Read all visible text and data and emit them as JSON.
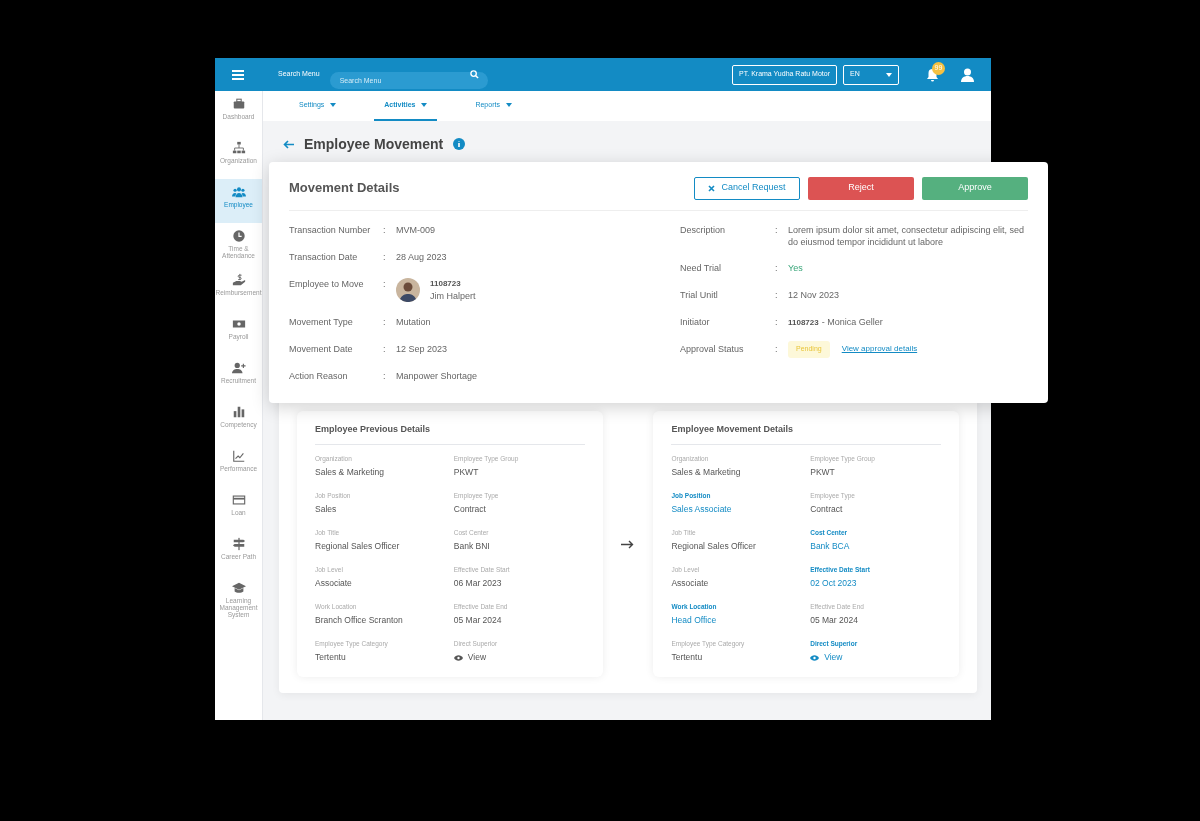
{
  "header": {
    "menu_label": "Search Menu",
    "search_placeholder": "Search Menu",
    "company": "PT. Krama Yudha Ratu Motor",
    "language": "EN",
    "notification_count": "99"
  },
  "sidebar": {
    "items": [
      {
        "label": "Dashboard",
        "selected": false
      },
      {
        "label": "Organization",
        "selected": false
      },
      {
        "label": "Employee",
        "selected": true
      },
      {
        "label": "Time & Attendance",
        "selected": false
      },
      {
        "label": "Reimbursement",
        "selected": false
      },
      {
        "label": "Payroll",
        "selected": false
      },
      {
        "label": "Recruitment",
        "selected": false
      },
      {
        "label": "Competency",
        "selected": false
      },
      {
        "label": "Performance",
        "selected": false
      },
      {
        "label": "Loan",
        "selected": false
      },
      {
        "label": "Career Path",
        "selected": false
      },
      {
        "label": "Learning Management System",
        "selected": false
      }
    ]
  },
  "tabs": [
    {
      "label": "Settings",
      "selected": false
    },
    {
      "label": "Activities",
      "selected": true
    },
    {
      "label": "Reports",
      "selected": false
    }
  ],
  "page_title": "Employee Movement",
  "details": {
    "title": "Movement Details",
    "actions": [
      {
        "label": "Cancel Request",
        "kind": "cancel"
      },
      {
        "label": "Reject",
        "kind": "reject"
      },
      {
        "label": "Approve",
        "kind": "approve"
      }
    ],
    "left_fields": [
      {
        "label": "Transaction Number",
        "separator": ":",
        "kind": "text",
        "value": "MVM-009"
      },
      {
        "label": "Transaction Date",
        "separator": ":",
        "kind": "text",
        "value": "28 Aug 2023"
      },
      {
        "label": "Employee to Move",
        "separator": ":",
        "kind": "employee",
        "id": "1108723",
        "value": "Jim Halpert"
      },
      {
        "label": "Movement Type",
        "separator": ":",
        "kind": "text",
        "value": "Mutation"
      },
      {
        "label": "Movement Date",
        "separator": ":",
        "kind": "text",
        "value": "12 Sep 2023"
      },
      {
        "label": "Action Reason",
        "separator": ":",
        "kind": "text",
        "value": "Manpower Shortage"
      }
    ],
    "right_fields": [
      {
        "label": "Description",
        "separator": ":",
        "kind": "text",
        "value": "Lorem ipsum dolor sit amet, consectetur adipiscing elit, sed do eiusmod tempor incididunt ut labore"
      },
      {
        "label": "Need Trial",
        "separator": ":",
        "kind": "accent",
        "value": "Yes"
      },
      {
        "label": "Trial Unitl",
        "separator": ":",
        "kind": "text",
        "value": "12 Nov 2023"
      },
      {
        "label": "Initiator",
        "separator": ":",
        "kind": "initiator",
        "id": "1108723",
        "value": "- Monica Geller"
      },
      {
        "label": "Approval Status",
        "separator": ":",
        "kind": "status",
        "value": "Pending",
        "link": "View approval details"
      }
    ]
  },
  "comparison": [
    {
      "title": "Employee Previous Details",
      "fields": [
        {
          "label": "Organization",
          "value": "Sales & Marketing",
          "changed": false,
          "kind": "text"
        },
        {
          "label": "Employee Type Group",
          "value": "PKWT",
          "changed": false,
          "kind": "text"
        },
        {
          "label": "Job Position",
          "value": "Sales",
          "changed": false,
          "kind": "text"
        },
        {
          "label": "Employee Type",
          "value": "Contract",
          "changed": false,
          "kind": "text"
        },
        {
          "label": "Job Title",
          "value": "Regional Sales Officer",
          "changed": false,
          "kind": "text"
        },
        {
          "label": "Cost Center",
          "value": "Bank BNI",
          "changed": false,
          "kind": "text"
        },
        {
          "label": "Job Level",
          "value": "Associate",
          "changed": false,
          "kind": "text"
        },
        {
          "label": "Effective Date Start",
          "value": "06 Mar 2023",
          "changed": false,
          "kind": "text"
        },
        {
          "label": "Work Location",
          "value": "Branch Office Scranton",
          "changed": false,
          "kind": "text"
        },
        {
          "label": "Effective Date End",
          "value": "05 Mar 2024",
          "changed": false,
          "kind": "text"
        },
        {
          "label": "Employee Type Category",
          "value": "Tertentu",
          "changed": false,
          "kind": "text"
        },
        {
          "label": "Direct Superior",
          "value": "View",
          "changed": false,
          "kind": "view"
        }
      ]
    },
    {
      "title": "Employee Movement Details",
      "fields": [
        {
          "label": "Organization",
          "value": "Sales & Marketing",
          "changed": false,
          "kind": "text"
        },
        {
          "label": "Employee Type Group",
          "value": "PKWT",
          "changed": false,
          "kind": "text"
        },
        {
          "label": "Job Position",
          "value": "Sales Associate",
          "changed": true,
          "kind": "text"
        },
        {
          "label": "Employee Type",
          "value": "Contract",
          "changed": false,
          "kind": "text"
        },
        {
          "label": "Job Title",
          "value": "Regional Sales Officer",
          "changed": false,
          "kind": "text"
        },
        {
          "label": "Cost Center",
          "value": "Bank BCA",
          "changed": true,
          "kind": "text"
        },
        {
          "label": "Job Level",
          "value": "Associate",
          "changed": false,
          "kind": "text"
        },
        {
          "label": "Effective Date Start",
          "value": "02 Oct 2023",
          "changed": true,
          "kind": "text"
        },
        {
          "label": "Work Location",
          "value": "Head Office",
          "changed": true,
          "kind": "text"
        },
        {
          "label": "Effective Date End",
          "value": "05 Mar 2024",
          "changed": false,
          "kind": "text"
        },
        {
          "label": "Employee Type Category",
          "value": "Tertentu",
          "changed": false,
          "kind": "text"
        },
        {
          "label": "Direct Superior",
          "value": "View",
          "changed": true,
          "kind": "view"
        }
      ]
    }
  ]
}
